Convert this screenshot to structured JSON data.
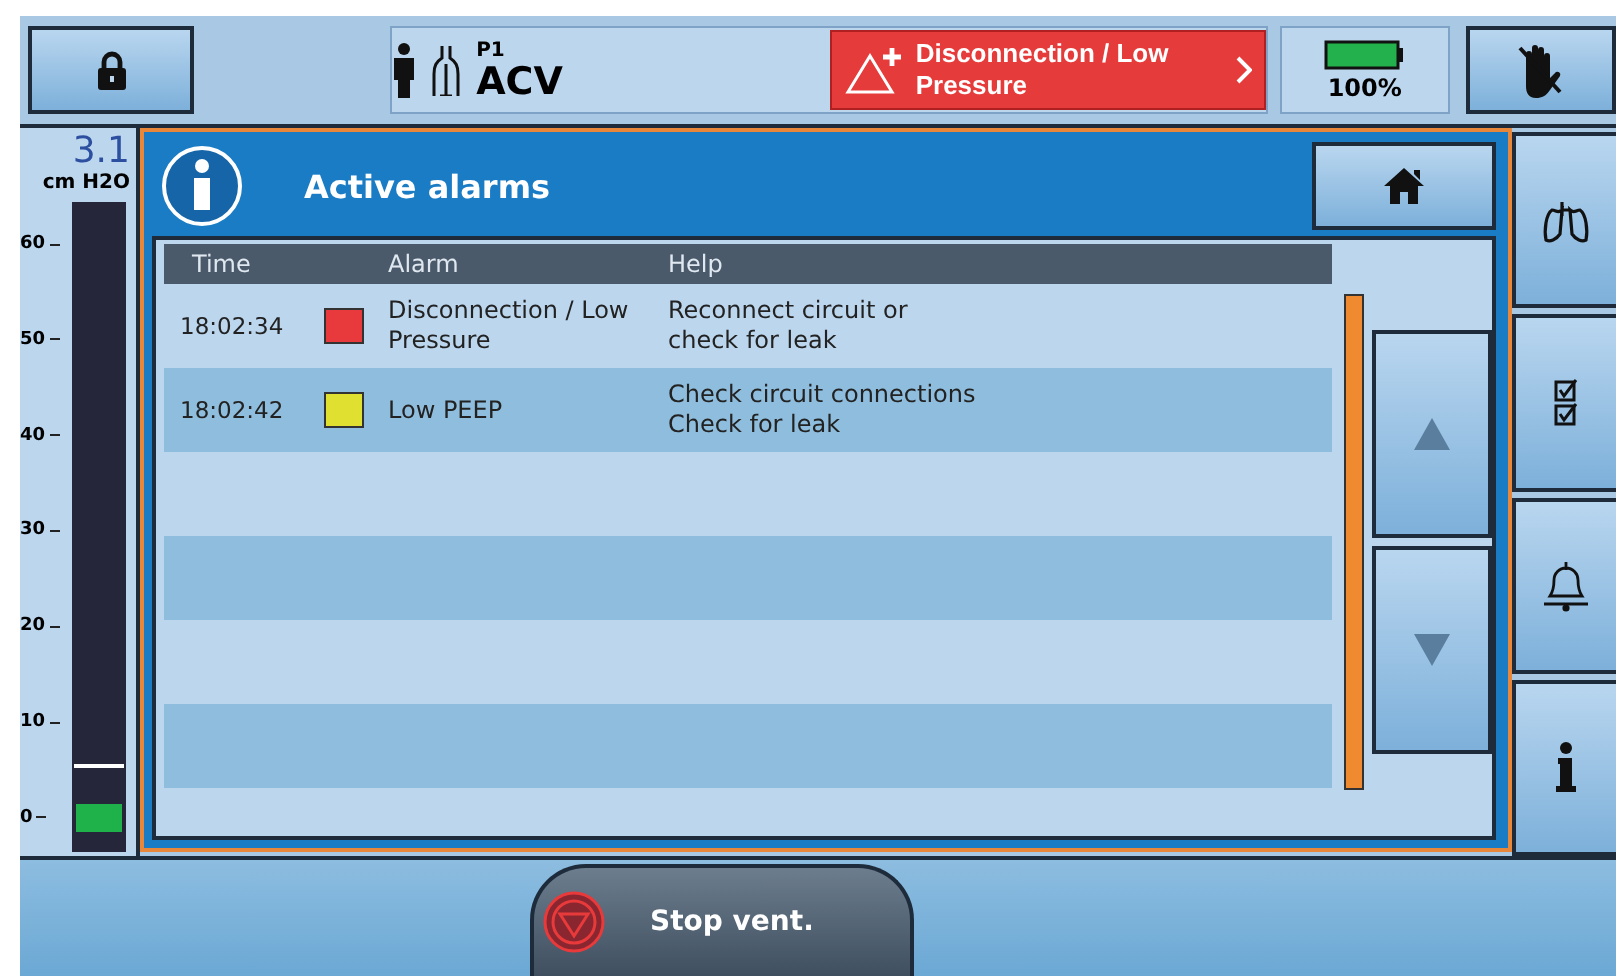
{
  "top_bar": {
    "patient": "P1",
    "mode": "ACV",
    "alarm_banner": "Disconnection / Low\nPressure",
    "battery_reading": "100%"
  },
  "gauge": {
    "value": "3.1",
    "unit": "cm H2O",
    "ticks": [
      "60",
      "50",
      "40",
      "30",
      "20",
      "10",
      "0"
    ],
    "level": 0.05
  },
  "panel": {
    "title": "Active alarms",
    "columns": [
      "Time",
      "Alarm",
      "Help"
    ],
    "rows": [
      {
        "time": "18:02:34",
        "color": "#e8393c",
        "alarm": "Disconnection / Low\nPressure",
        "help": "Reconnect circuit or\ncheck for leak"
      },
      {
        "time": "18:02:42",
        "color": "#e0e030",
        "alarm": "Low PEEP",
        "help": "Check circuit connections\nCheck for leak"
      }
    ]
  },
  "stop_button": "Stop vent."
}
